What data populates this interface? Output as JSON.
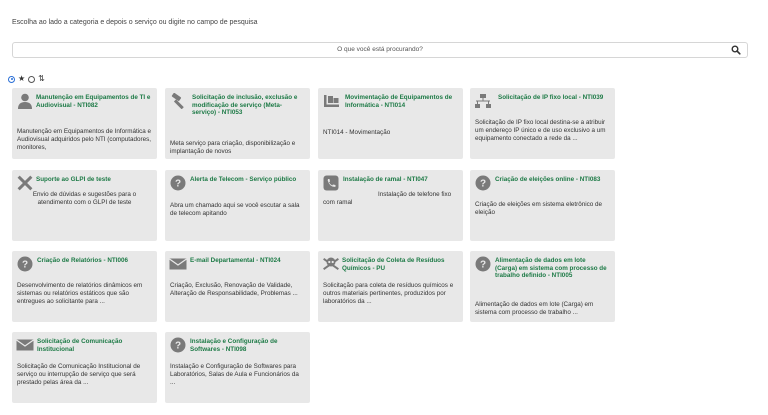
{
  "intro": "Escolha ao lado a categoria e depois o serviço ou digite no campo de pesquisa",
  "search": {
    "placeholder": "O que você está procurando?"
  },
  "sort": {
    "favorite_glyph": "★",
    "alpha_glyph": "⇅"
  },
  "cards": [
    {
      "icon": "user-icon",
      "title": "Manutenção em Equipamentos de TI e Audiovisual - NTI082",
      "desc": "Manutenção em Equipamentos de Informática e Audiovisual adquiridos pelo NTI (computadores, monitores,"
    },
    {
      "icon": "hammer-icon",
      "title": "Solicitação de inclusão, exclusão e modificação de serviço (Meta-serviço) - NTI053",
      "desc": "Meta serviço para criação, disponibilização e implantação de novos"
    },
    {
      "icon": "truck-loading-icon",
      "title": "Movimentação de Equipamentos de Informática - NTI014",
      "desc": "NTI014 - Movimentação"
    },
    {
      "icon": "network-icon",
      "title": "Solicitação de IP fixo local - NTI039",
      "desc": "Solicitação de IP fixo local destina-se a atribuir um endereço IP único e de uso exclusivo a um equipamento conectado a rede da ..."
    },
    {
      "icon": "tools-icon",
      "title": "Suporte ao GLPI de teste",
      "desc": "Envio de dúvidas e sugestões para o atendimento com o GLPI de teste"
    },
    {
      "icon": "question-icon",
      "title": "Alerta de Telecom - Serviço público",
      "desc": "Abra um chamado aqui se você escutar a sala de telecom apitando"
    },
    {
      "icon": "phone-icon",
      "title": "Instalação de ramal - NTI047",
      "desc": "Instalação de telefone fixo com ramal"
    },
    {
      "icon": "question-icon",
      "title": "Criação de eleições online - NTI083",
      "desc": "Criação de eleições em sistema eletrônico de eleição"
    },
    {
      "icon": "question-icon",
      "title": "Criação de Relatórios - NTI006",
      "desc": "Desenvolvimento de relatórios dinâmicos em sistemas ou relatórios estáticos que são entregues ao solicitante para ..."
    },
    {
      "icon": "envelope-icon",
      "title": "E-mail Departamental - NTI024",
      "desc": "Criação, Exclusão, Renovação de Validade, Alteração de Responsabilidade, Problemas ..."
    },
    {
      "icon": "skull-crossbones-icon",
      "title": "Solicitação de Coleta de Resíduos Químicos - PU",
      "desc": "Solicitação para coleta de resíduos químicos e outros materiais pertinentes, produzidos por laboratórios da ..."
    },
    {
      "icon": "question-icon",
      "title": "Alimentação de dados em lote (Carga) em sistema com processo de trabalho definido - NTI005",
      "desc": "Alimentação de dados em lote (Carga) em sistema com processo de trabalho ..."
    },
    {
      "icon": "envelope-icon",
      "title": "Solicitação de Comunicação Institucional",
      "desc": "Solicitação de Comunicação Institucional de serviço ou interrupção de serviço que será prestado pelas área da ..."
    },
    {
      "icon": "question-icon",
      "title": "Instalação e Configuração de Softwares - NTI098",
      "desc": "Instalação e Configuração de Softwares para Laboratórios, Salas de Aula e Funcionários da ..."
    }
  ]
}
